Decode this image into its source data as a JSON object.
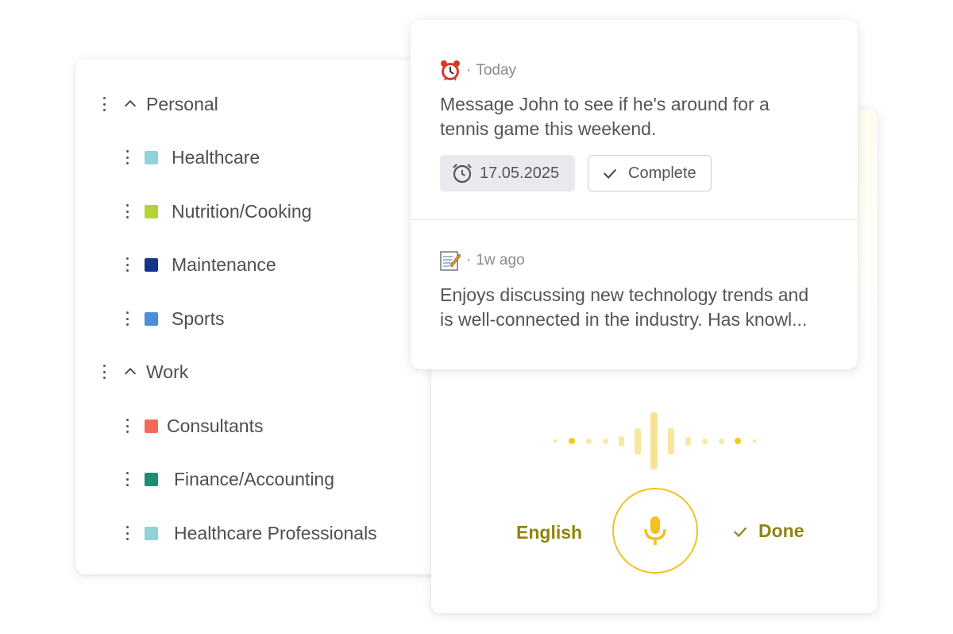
{
  "categories": {
    "groups": [
      {
        "label": "Personal",
        "items": [
          {
            "label": "Healthcare",
            "color": "#90d3d8"
          },
          {
            "label": "Nutrition/Cooking",
            "color": "#b3d534"
          },
          {
            "label": "Maintenance",
            "color": "#14338f"
          },
          {
            "label": "Sports",
            "color": "#4a8fdb"
          }
        ]
      },
      {
        "label": "Work",
        "items": [
          {
            "label": "Consultants",
            "color": "#f26b5a"
          },
          {
            "label": "Finance/Accounting",
            "color": "#1d8f70"
          },
          {
            "label": "Healthcare Professionals",
            "color": "#90d3d8"
          }
        ]
      }
    ]
  },
  "reminder": {
    "icon": "alarm-clock-icon",
    "meta_time": "Today",
    "text_line1": "Message John to see if he's around for a",
    "text_line2": "tennis game this weekend.",
    "date_chip": "17.05.2025",
    "complete_label": "Complete"
  },
  "note": {
    "icon": "memo-icon",
    "meta_time": "1w ago",
    "text_line1": "Enjoys discussing new technology trends and",
    "text_line2": "is well-connected in the industry. Has knowl..."
  },
  "voice": {
    "language_label": "English",
    "done_label": "Done",
    "accent": "#f2c222",
    "text_color": "#8f8410"
  }
}
